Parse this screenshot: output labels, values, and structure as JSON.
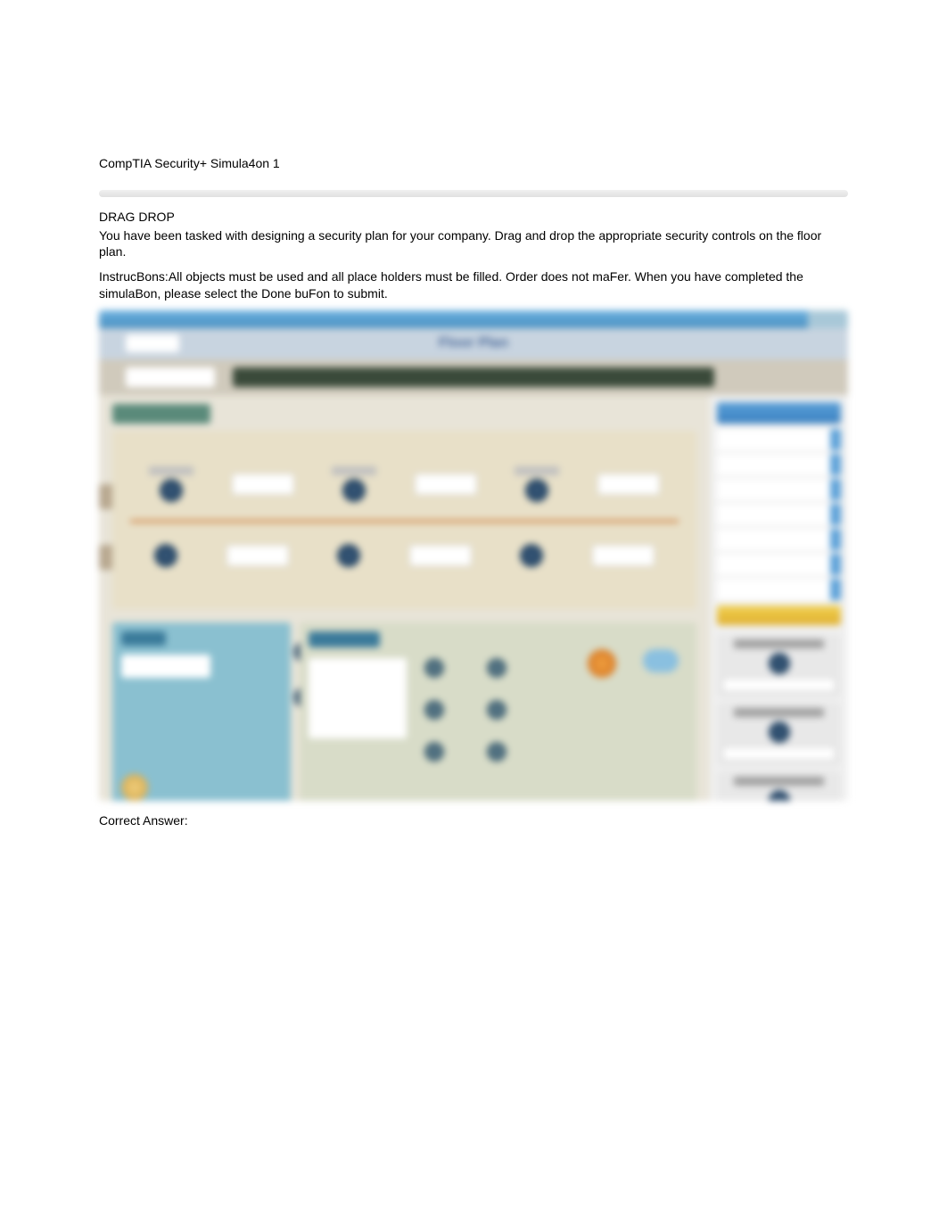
{
  "header": {
    "title": "CompTIA Security+ Simula4on 1"
  },
  "question": {
    "type": "DRAG DROP",
    "text": "You have been tasked with designing a security plan for your company. Drag and drop the appropriate security controls on the floor plan.",
    "instructions": "InstrucBons:All objects must be used and all place holders must be filled. Order does not maFer. When you have completed the simulaBon, please select the Done buFon to submit."
  },
  "simulation": {
    "title": "Floor Plan"
  },
  "answer": {
    "label": "Correct Answer:"
  }
}
